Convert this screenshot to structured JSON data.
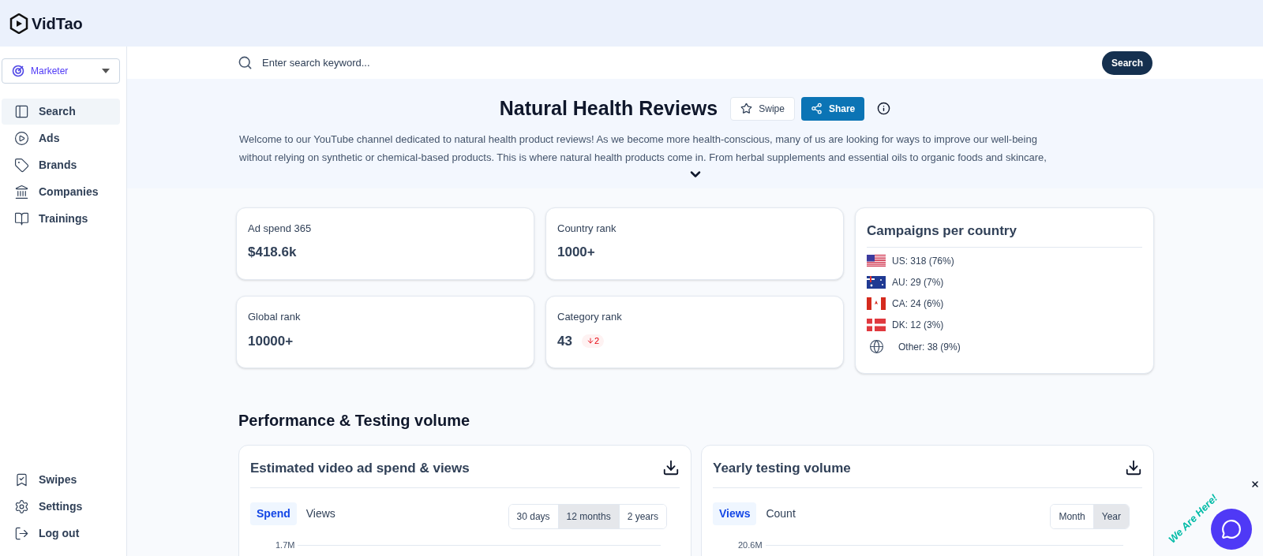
{
  "brand": {
    "name": "VidTao"
  },
  "role_select": {
    "value": "Marketer"
  },
  "sidebar": {
    "items": [
      {
        "label": "Search",
        "selected": true
      },
      {
        "label": "Ads",
        "selected": false
      },
      {
        "label": "Brands",
        "selected": false
      },
      {
        "label": "Companies",
        "selected": false
      },
      {
        "label": "Trainings",
        "selected": false
      }
    ],
    "bottom_items": [
      {
        "label": "Swipes"
      },
      {
        "label": "Settings"
      },
      {
        "label": "Log out"
      }
    ]
  },
  "search": {
    "placeholder": "Enter search keyword...",
    "button": "Search"
  },
  "channel": {
    "title": "Natural Health Reviews",
    "swipe_button": "Swipe",
    "share_button": "Share",
    "description_lines": [
      "Welcome to our YouTube channel dedicated to natural health product reviews! As we become more health-conscious, many of us are looking for ways to improve our well-being",
      "without relying on synthetic or chemical-based products. This is where natural health products come in. From herbal supplements and essential oils to organic foods and skincare,"
    ]
  },
  "stats": [
    {
      "label": "Ad spend 365",
      "value": "$418.6k"
    },
    {
      "label": "Country rank",
      "value": "1000+"
    },
    {
      "label": "Global rank",
      "value": "10000+"
    },
    {
      "label": "Category rank",
      "value": "43",
      "change": "2"
    }
  ],
  "campaigns": {
    "title": "Campaigns per country",
    "rows": [
      {
        "kind": "country",
        "text": "US: 318 (76%)"
      },
      {
        "kind": "country",
        "text": "AU: 29 (7%)"
      },
      {
        "kind": "country",
        "text": "CA: 24 (6%)"
      },
      {
        "kind": "country",
        "text": "DK: 12 (3%)"
      },
      {
        "kind": "other",
        "text": "Other: 38 (9%)"
      }
    ]
  },
  "section_title": "Performance & Testing volume",
  "charts": [
    {
      "title": "Estimated video ad spend & views",
      "tabs": [
        {
          "label": "Spend",
          "selected": true
        },
        {
          "label": "Views",
          "selected": false
        }
      ],
      "ranges": [
        {
          "label": "30 days",
          "selected": false
        },
        {
          "label": "12 months",
          "selected": true
        },
        {
          "label": "2 years",
          "selected": false
        }
      ],
      "top_tick": "1.7M"
    },
    {
      "title": "Yearly testing volume",
      "tabs": [
        {
          "label": "Views",
          "selected": true
        },
        {
          "label": "Count",
          "selected": false
        }
      ],
      "ranges": [
        {
          "label": "Month",
          "selected": false
        },
        {
          "label": "Year",
          "selected": true
        }
      ],
      "top_tick": "20.6M"
    }
  ],
  "chat_widget": {
    "caption": "We Are Here!"
  }
}
